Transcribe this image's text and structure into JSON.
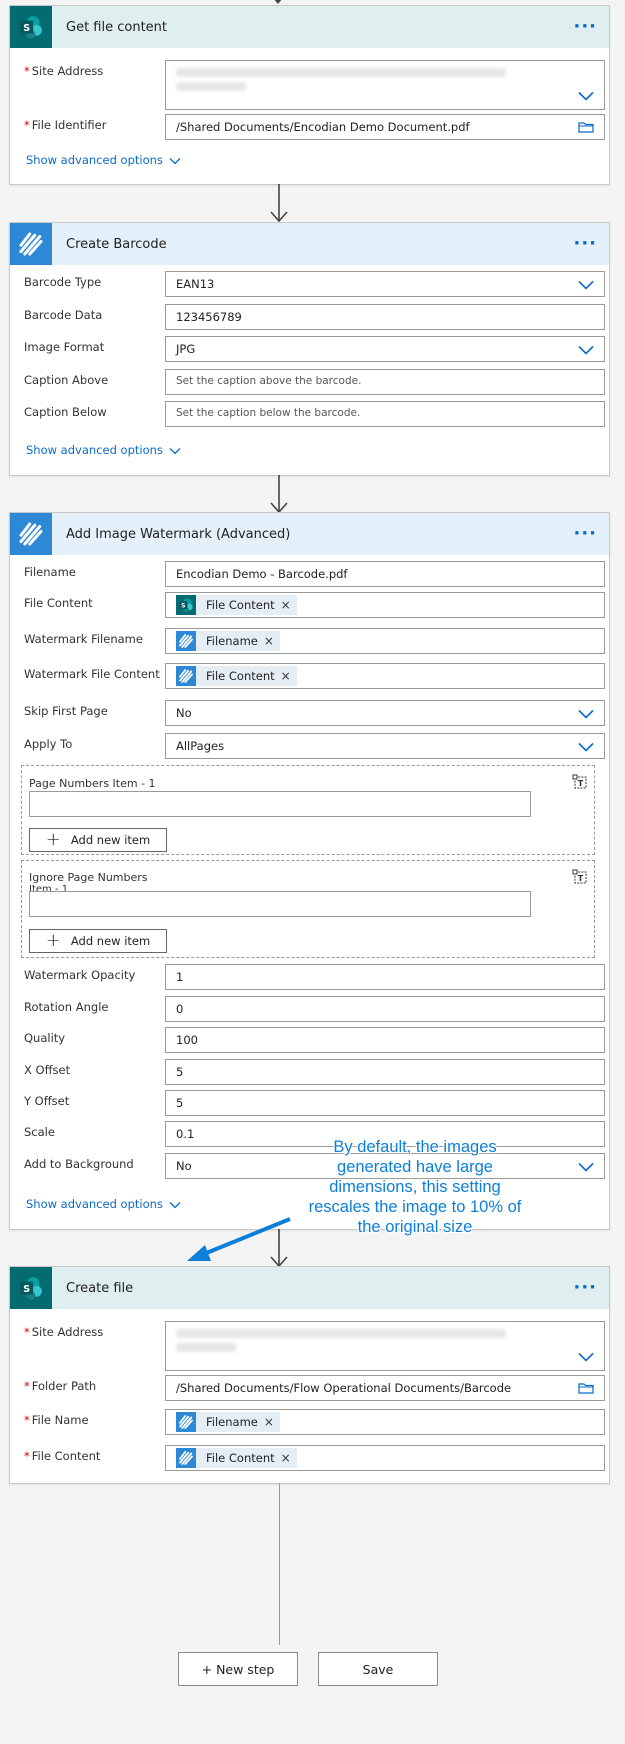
{
  "card1": {
    "title": "Get file content",
    "site_address_label": "Site Address",
    "file_identifier_label": "File Identifier",
    "file_identifier_value": "/Shared Documents/Encodian Demo Document.pdf",
    "show_advanced": "Show advanced options"
  },
  "card2": {
    "title": "Create Barcode",
    "barcode_type_label": "Barcode Type",
    "barcode_type_value": "EAN13",
    "barcode_data_label": "Barcode Data",
    "barcode_data_value": "123456789",
    "image_format_label": "Image Format",
    "image_format_value": "JPG",
    "caption_above_label": "Caption Above",
    "caption_above_placeholder": "Set the caption above the barcode.",
    "caption_below_label": "Caption Below",
    "caption_below_placeholder": "Set the caption below the barcode.",
    "show_advanced": "Show advanced options"
  },
  "card3": {
    "title": "Add Image Watermark (Advanced)",
    "filename_label": "Filename",
    "filename_value": "Encodian Demo - Barcode.pdf",
    "file_content_label": "File Content",
    "file_content_token": "File Content",
    "wm_filename_label": "Watermark Filename",
    "wm_filename_token": "Filename",
    "wm_file_content_label": "Watermark File Content",
    "wm_file_content_token": "File Content",
    "skip_first_label": "Skip First Page",
    "skip_first_value": "No",
    "apply_to_label": "Apply To",
    "apply_to_value": "AllPages",
    "page_numbers_label": "Page Numbers Item - 1",
    "ignore_label_line1": "Ignore Page Numbers",
    "ignore_label_line2": "Item - 1",
    "add_new_item": "Add new item",
    "opacity_label": "Watermark Opacity",
    "opacity_value": "1",
    "rotation_label": "Rotation Angle",
    "rotation_value": "0",
    "quality_label": "Quality",
    "quality_value": "100",
    "xoffset_label": "X Offset",
    "xoffset_value": "5",
    "yoffset_label": "Y Offset",
    "yoffset_value": "5",
    "scale_label": "Scale",
    "scale_value": "0.1",
    "background_label": "Add to Background",
    "background_value": "No",
    "show_advanced": "Show advanced options"
  },
  "card4": {
    "title": "Create file",
    "site_address_label": "Site Address",
    "folder_path_label": "Folder Path",
    "folder_path_value": "/Shared Documents/Flow Operational Documents/Barcode",
    "file_name_label": "File Name",
    "file_name_token": "Filename",
    "file_content_label": "File Content",
    "file_content_token": "File Content"
  },
  "callout": {
    "text": "By default, the images generated have large dimensions, this setting rescales the image to 10% of the original size"
  },
  "footer": {
    "new_step": "+ New step",
    "save": "Save"
  },
  "colors": {
    "accent": "#0b6ac8",
    "sharepoint": "#036c70",
    "encodian": "#2d89d6",
    "callout": "#0b7fd9"
  }
}
